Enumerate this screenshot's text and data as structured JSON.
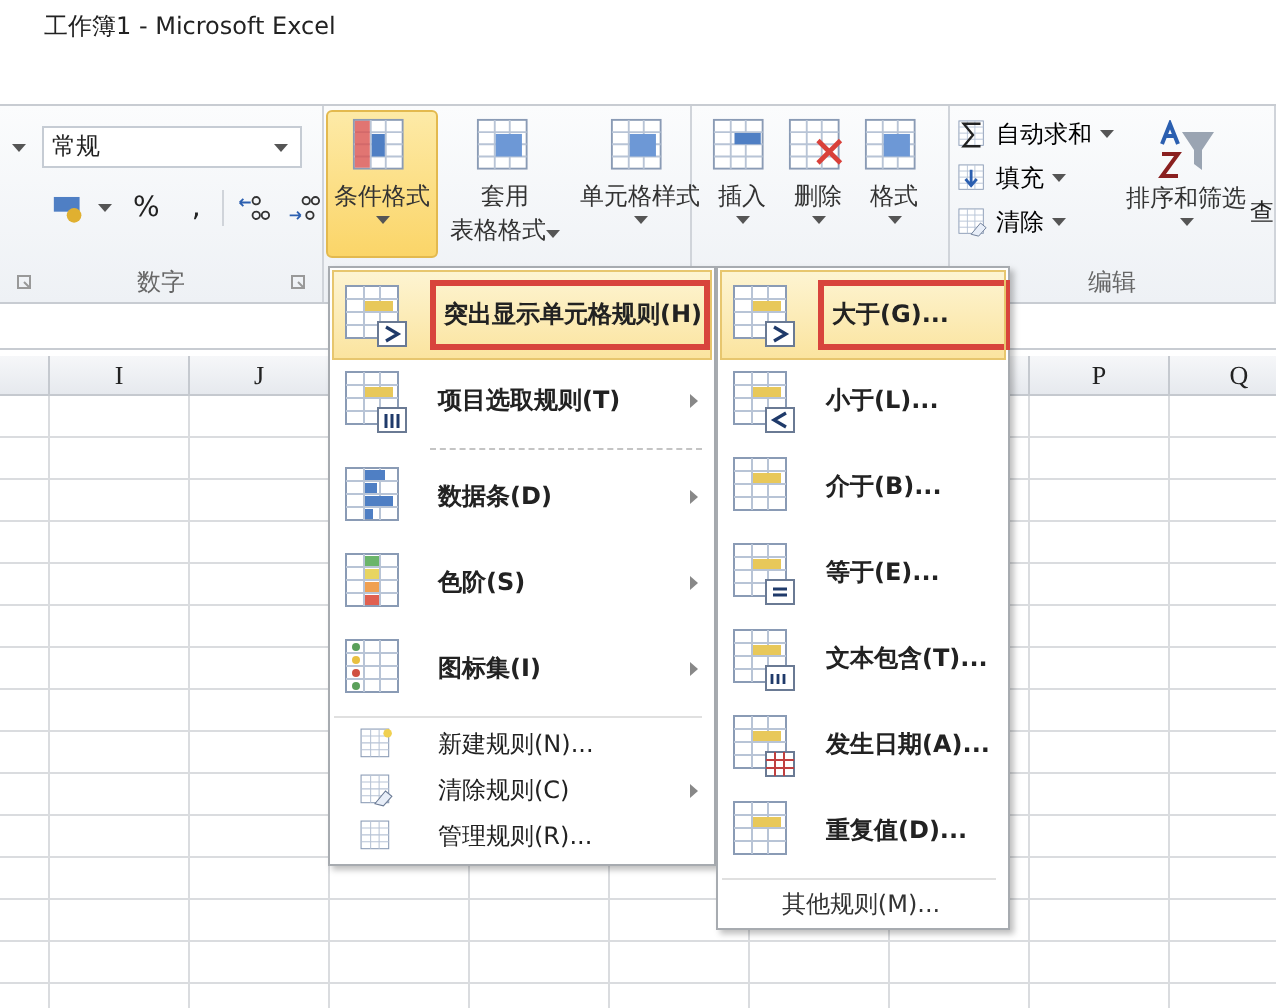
{
  "window": {
    "title": "工作簿1 - Microsoft Excel"
  },
  "ribbon": {
    "number_group": {
      "label": "数字",
      "format_dropdown": {
        "value": "常规"
      },
      "percent": "%",
      "comma": ","
    },
    "styles_group": {
      "buttons": [
        {
          "kind": "conditional",
          "lines": [
            "条件格式"
          ],
          "selected": true
        },
        {
          "kind": "table",
          "lines": [
            "套用",
            "表格格式"
          ],
          "selected": false
        },
        {
          "kind": "cellstyle",
          "lines": [
            "单元格样式"
          ],
          "selected": false
        }
      ]
    },
    "cells_group": {
      "buttons": [
        {
          "kind": "insert",
          "label": "插入"
        },
        {
          "kind": "delete",
          "label": "删除"
        },
        {
          "kind": "format",
          "label": "格式"
        }
      ]
    },
    "editing_group": {
      "label": "编辑",
      "small_buttons": [
        {
          "kind": "sum",
          "label": "自动求和"
        },
        {
          "kind": "fill",
          "label": "填充"
        },
        {
          "kind": "clear",
          "label": "清除"
        }
      ],
      "sort_button": {
        "label": "排序和筛选"
      },
      "cut_button": {
        "label": "查"
      }
    }
  },
  "sheet": {
    "columns": [
      "I",
      "J",
      "P",
      "Q"
    ]
  },
  "menu": {
    "items": [
      {
        "kind": "highlight",
        "label": "突出显示单元格规则(H)",
        "submenu": true,
        "selected": true
      },
      {
        "kind": "top10",
        "label": "项目选取规则(T)",
        "submenu": true,
        "selected": false
      },
      {
        "kind": "databar",
        "label": "数据条(D)",
        "submenu": true,
        "selected": false
      },
      {
        "kind": "colorscale",
        "label": "色阶(S)",
        "submenu": true,
        "selected": false
      },
      {
        "kind": "iconset",
        "label": "图标集(I)",
        "submenu": true,
        "selected": false
      },
      {
        "kind": "new",
        "label": "新建规则(N)...",
        "submenu": false,
        "selected": false
      },
      {
        "kind": "clearrule",
        "label": "清除规则(C)",
        "submenu": true,
        "selected": false
      },
      {
        "kind": "manage",
        "label": "管理规则(R)...",
        "submenu": false,
        "selected": false
      }
    ]
  },
  "submenu": {
    "items": [
      {
        "kind": "greater",
        "label": "大于(G)...",
        "selected": true
      },
      {
        "kind": "less",
        "label": "小于(L)...",
        "selected": false
      },
      {
        "kind": "between",
        "label": "介于(B)...",
        "selected": false
      },
      {
        "kind": "equal",
        "label": "等于(E)...",
        "selected": false
      },
      {
        "kind": "text",
        "label": "文本包含(T)...",
        "selected": false
      },
      {
        "kind": "date",
        "label": "发生日期(A)...",
        "selected": false
      },
      {
        "kind": "duplicate",
        "label": "重复值(D)...",
        "selected": false
      }
    ],
    "more": "其他规则(M)..."
  }
}
